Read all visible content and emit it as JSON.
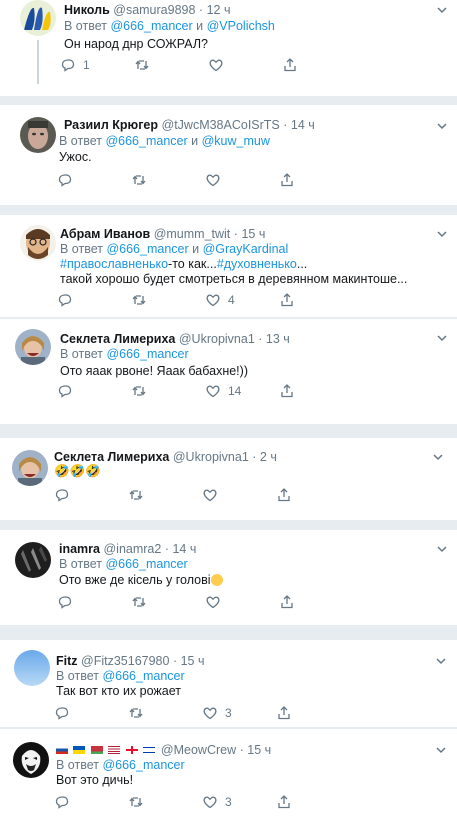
{
  "tweets": [
    {
      "name": "Николь",
      "handle": "@samura9898",
      "time": "12 ч",
      "reply_prefix": "В ответ",
      "reply_to1": "@666_mancer",
      "reply_conj": "и",
      "reply_to2": "@VPolichsh",
      "text": "Он народ днр СОЖРАЛ?",
      "replies": "1",
      "retweets": "",
      "likes": ""
    },
    {
      "name": "Разиил Крюгер",
      "handle": "@tJwcM38ACoISrTS",
      "time": "14 ч",
      "reply_prefix": "В ответ",
      "reply_to1": "@666_mancer",
      "reply_conj": "и",
      "reply_to2": "@kuw_muw",
      "text": "Ужос.",
      "replies": "",
      "retweets": "",
      "likes": ""
    },
    {
      "name": "Абрам Иванов",
      "handle": "@mumm_twit",
      "time": "15 ч",
      "reply_prefix": "В ответ",
      "reply_to1": "@666_mancer",
      "reply_conj": "и",
      "reply_to2": "@GrayKardinal",
      "text_tag1": "#православненько",
      "text_mid": "-то как...",
      "text_tag2": "#духовненько",
      "text_tail": "...",
      "text_line2": "такой хорошо будет смотреться в деревянном макинтоше...",
      "replies": "",
      "retweets": "",
      "likes": "4"
    },
    {
      "name": "Секлета Лимериха",
      "handle": "@Ukropivna1",
      "time": "13 ч",
      "reply_prefix": "В ответ",
      "reply_to1": "@666_mancer",
      "text": "Ото яаак рвоне! Яаак бабахне!))",
      "replies": "",
      "retweets": "",
      "likes": "14"
    },
    {
      "name": "Секлета Лимериха",
      "handle": "@Ukropivna1",
      "time": "2 ч",
      "emoji_text": "🤣🤣🤣",
      "replies": "",
      "retweets": "",
      "likes": ""
    },
    {
      "name": "inamra",
      "handle": "@inamra2",
      "time": "14 ч",
      "reply_prefix": "В ответ",
      "reply_to1": "@666_mancer",
      "text": "Ото вже де кісель у голові",
      "replies": "",
      "retweets": "",
      "likes": ""
    },
    {
      "name": "Fitz",
      "handle": "@Fitz35167980",
      "time": "15 ч",
      "reply_prefix": "В ответ",
      "reply_to1": "@666_mancer",
      "text": "Так вот кто их рожает",
      "replies": "",
      "retweets": "",
      "likes": "3"
    },
    {
      "name_flags": [
        "ru",
        "ua",
        "by",
        "us",
        "ge",
        "il"
      ],
      "handle": "@MeowCrew",
      "time": "15 ч",
      "reply_prefix": "В ответ",
      "reply_to1": "@666_mancer",
      "text": "Вот это дичь!",
      "replies": "",
      "retweets": "",
      "likes": "3"
    }
  ],
  "dot": "·",
  "colors": {
    "link": "#1b95e0",
    "muted": "#657786",
    "separator": "#e6ecf0",
    "text": "#14171a"
  }
}
